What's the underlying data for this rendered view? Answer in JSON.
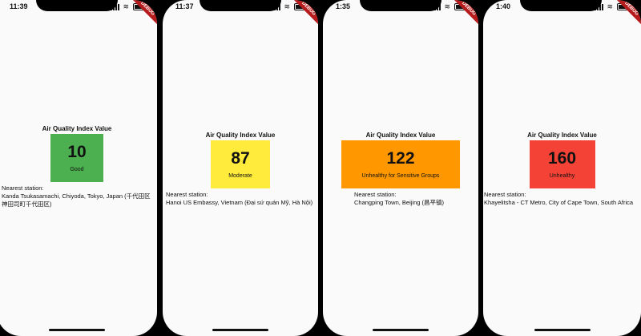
{
  "screens": [
    {
      "time": "11:39",
      "title": "Air Quality Index Value",
      "aqi": "10",
      "status": "Good",
      "color": "#4caf50",
      "station_label": "Nearest station:",
      "station_name": " Kanda Tsukasamachi, Chiyoda, Tokyo, Japan (千代田区神田司町千代田区)"
    },
    {
      "time": "11:37",
      "title": "Air Quality Index Value",
      "aqi": "87",
      "status": "Moderate",
      "color": "#ffeb3b",
      "station_label": "Nearest station:",
      "station_name": " Hanoi US Embassy, Vietnam (Đại sứ quán Mỹ, Hà Nội)"
    },
    {
      "time": "1:35",
      "title": "Air Quality Index Value",
      "aqi": "122",
      "status": "Unhealthy for Sensitive Groups",
      "color": "#ff9800",
      "station_label": "Nearest station:",
      "station_name": " Changping Town, Beijing (昌平镇)"
    },
    {
      "time": "1:40",
      "title": "Air Quality Index Value",
      "aqi": "160",
      "status": "Unhealthy",
      "color": "#f44336",
      "station_label": "Nearest station:",
      "station_name": " Khayelitsha - CT Metro, City of Cape Town, South Africa"
    }
  ],
  "debug_banner": "DEBUG",
  "colors": {
    "background": "#fafafa",
    "bezel": "#000000"
  }
}
